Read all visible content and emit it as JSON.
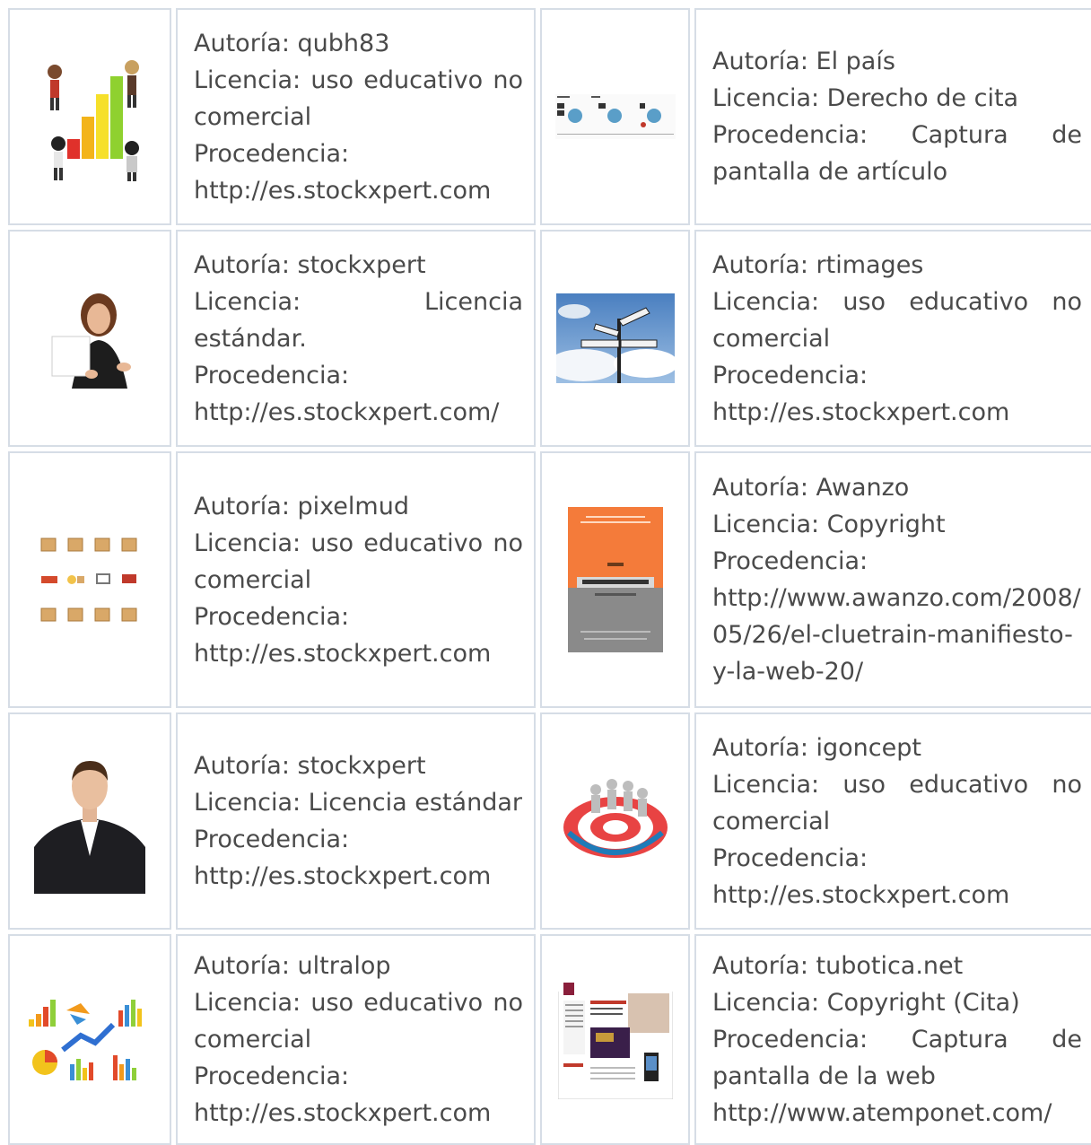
{
  "rows": [
    {
      "left": {
        "image": "people-growth-chart-illustration",
        "autoria": "Autoría: qubh83",
        "licencia": "Licencia: uso educativo no comercial",
        "procedencia": "Procedencia:",
        "url": "http://es.stockxpert.com"
      },
      "right": {
        "image": "article-screenshot-pie-charts",
        "autoria": "Autoría: El país",
        "licencia": "Licencia: Derecho de cita",
        "procedencia": "Procedencia: Captura de pantalla de artículo",
        "url": ""
      }
    },
    {
      "left": {
        "image": "woman-holding-paper-photo",
        "autoria": "Autoría: stockxpert",
        "licencia": "Licencia: Licencia estándar.",
        "procedencia": "Procedencia:",
        "url": "http://es.stockxpert.com/"
      },
      "right": {
        "image": "signpost-price-product-placement-promotion",
        "autoria": "Autoría: rtimages",
        "licencia": "Licencia: uso educativo no comercial",
        "procedencia": "Procedencia:",
        "url": "http://es.stockxpert.com"
      }
    },
    {
      "left": {
        "image": "shipping-boxes-icons",
        "autoria": "Autoría: pixelmud",
        "licencia": "Licencia: uso educativo no comercial",
        "procedencia": "Procedencia:",
        "url": "http://es.stockxpert.com"
      },
      "right": {
        "image": "cluetrain-manifesto-book-cover",
        "autoria": "Autoría: Awanzo",
        "licencia": "Licencia: Copyright",
        "procedencia": "Procedencia:",
        "url": "http://www.awanzo.com/2008/05/26/el-cluetrain-manifiesto-y-la-web-20/"
      }
    },
    {
      "left": {
        "image": "young-man-suit-photo",
        "autoria": "Autoría: stockxpert",
        "licencia": "Licencia: Licencia estándar",
        "procedencia": "Procedencia:",
        "url": "http://es.stockxpert.com"
      },
      "right": {
        "image": "target-market-customers-3d",
        "autoria": "Autoría: igoncept",
        "licencia": "Licencia: uso educativo no comercial",
        "procedencia": "Procedencia:",
        "url": "http://es.stockxpert.com"
      }
    },
    {
      "left": {
        "image": "colorful-charts-icons",
        "autoria": "Autoría: ultralop",
        "licencia": "Licencia: uso educativo no comercial",
        "procedencia": "Procedencia:",
        "url": "http://es.stockxpert.com"
      },
      "right": {
        "image": "website-screenshot-tubotica",
        "autoria": "Autoría: tubotica.net",
        "licencia": "Licencia: Copyright (Cita)",
        "procedencia": "Procedencia: Captura de pantalla de la web",
        "url": "http://www.atemponet.com/"
      }
    }
  ]
}
